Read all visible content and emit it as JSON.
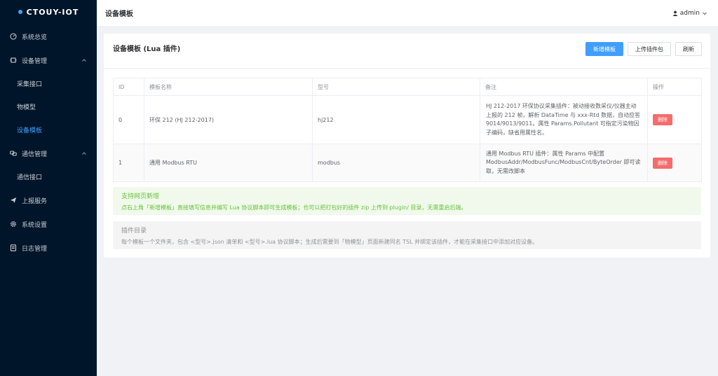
{
  "brand": {
    "name": "CTOUY-IOT"
  },
  "sidebar": {
    "items": [
      {
        "label": "系统总览",
        "icon": "dashboard-icon"
      },
      {
        "label": "设备管理",
        "icon": "chip-icon",
        "expanded": true,
        "children": [
          {
            "label": "采集接口",
            "active": false
          },
          {
            "label": "物模型",
            "active": false
          },
          {
            "label": "设备模板",
            "active": true
          }
        ]
      },
      {
        "label": "通信管理",
        "icon": "link-icon",
        "expanded": true,
        "children": [
          {
            "label": "通信接口",
            "active": false
          }
        ]
      },
      {
        "label": "上报服务",
        "icon": "send-icon"
      },
      {
        "label": "系统设置",
        "icon": "gear-icon"
      },
      {
        "label": "日志管理",
        "icon": "document-icon"
      }
    ]
  },
  "header": {
    "title": "设备模板",
    "user": "admin"
  },
  "card": {
    "title": "设备模板 (Lua 插件)",
    "buttons": {
      "add": "新增模板",
      "upload": "上传插件包",
      "refresh": "刷新"
    }
  },
  "table": {
    "columns": [
      "ID",
      "模板名称",
      "型号",
      "备注",
      "操作"
    ],
    "rows": [
      {
        "id": "0",
        "name": "环保 212 (HJ 212-2017)",
        "model": "hj212",
        "note": "HJ 212-2017 环保协议采集插件：被动接收数采仪/仪器主动上报的 212 帧，解析 DataTime 与 xxx-Rtd 数据，自动应答 9014/9013/9011。属性 Params.Pollutant 可指定污染物因子编码，缺省用属性名。",
        "action": "删除"
      },
      {
        "id": "1",
        "name": "通用 Modbus RTU",
        "model": "modbus",
        "note": "通用 Modbus RTU 插件：属性 Params 中配置 ModbusAddr/ModbusFunc/ModbusCnt/ByteOrder 即可读取，无需改脚本",
        "action": "删除"
      }
    ]
  },
  "tips": {
    "green": {
      "title": "支持网页新增",
      "text": "点右上角「新增模板」直接填写信息并编写 Lua 协议脚本即可生成模板；也可以把打包好的插件 zip 上传到 plugin/ 目录，无需重启后端。"
    },
    "gray": {
      "title": "插件目录",
      "text": "每个模板一个文件夹，包含 <型号>.json 清单和 <型号>.lua 协议脚本；生成后需要到「物模型」页面新建同名 TSL 并绑定该插件，才能在采集接口中添加对应设备。"
    }
  },
  "colors": {
    "sidebar_bg": "#001529",
    "accent": "#409eff",
    "danger": "#f56c6c",
    "success": "#67c23a"
  }
}
